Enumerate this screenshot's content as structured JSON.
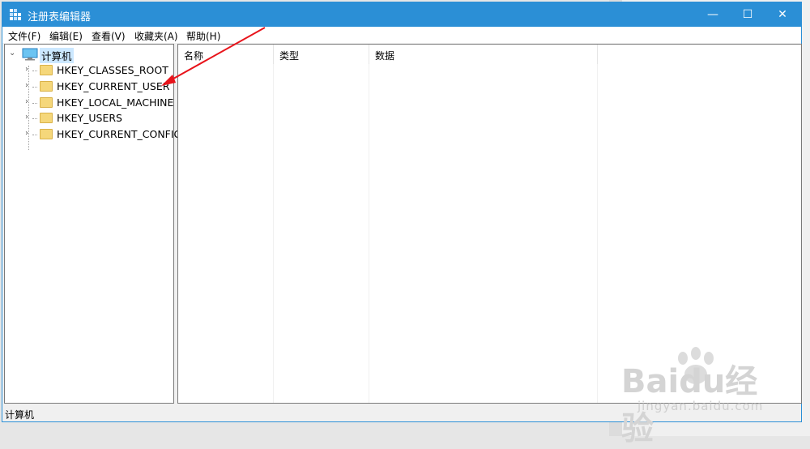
{
  "window": {
    "title": "注册表编辑器",
    "controls": {
      "minimize": "—",
      "maximize": "☐",
      "close": "✕"
    }
  },
  "menu": [
    "文件(F)",
    "编辑(E)",
    "查看(V)",
    "收藏夹(A)",
    "帮助(H)"
  ],
  "tree": {
    "root": "计算机",
    "children": [
      "HKEY_CLASSES_ROOT",
      "HKEY_CURRENT_USER",
      "HKEY_LOCAL_MACHINE",
      "HKEY_USERS",
      "HKEY_CURRENT_CONFIG"
    ]
  },
  "columns": [
    "名称",
    "类型",
    "数据"
  ],
  "status": "计算机",
  "watermark": {
    "main": "Baidu经验",
    "sub": "jingyan.baidu.com"
  },
  "colors": {
    "titlebar": "#2b8fd6",
    "annotation_arrow": "#e8141b"
  }
}
